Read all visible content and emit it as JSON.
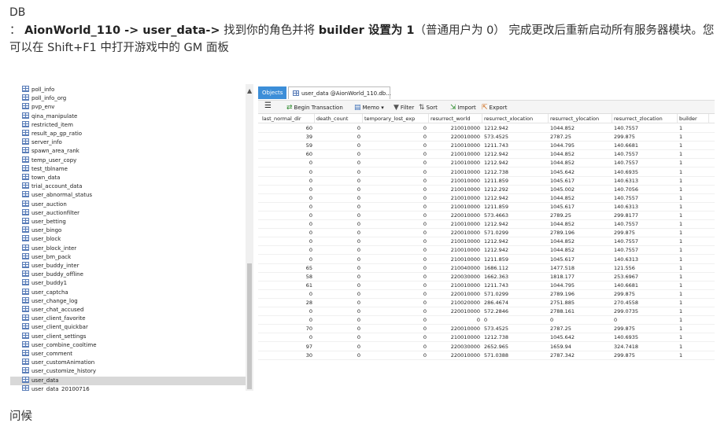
{
  "page": {
    "db_label": "DB",
    "instruction_prefix": "：",
    "instruction_path": "AionWorld_110 -> user_data->",
    "instruction_mid": " 找到你的角色并将 ",
    "instruction_bold2": "builder 设置为 1",
    "instruction_rest": "（普通用户为 0） 完成更改后重新启动所有服务器模块。您可以在 Shift+F1 中打开游戏中的 GM 面板",
    "greeting": "问候"
  },
  "tree": {
    "icon": "table-icon",
    "items": [
      "poll_info",
      "poll_info_org",
      "pvp_env",
      "qina_manipulate",
      "restricted_item",
      "result_ap_gp_ratio",
      "server_info",
      "spawn_area_rank",
      "temp_user_copy",
      "test_tblname",
      "town_data",
      "trial_account_data",
      "user_abnormal_status",
      "user_auction",
      "user_auctionfilter",
      "user_betting",
      "user_bingo",
      "user_block",
      "user_block_inter",
      "user_bm_pack",
      "user_buddy_inter",
      "user_buddy_offline",
      "user_buddy1",
      "user_captcha",
      "user_change_log",
      "user_chat_accused",
      "user_client_favorite",
      "user_client_quickbar",
      "user_client_settings",
      "user_combine_cooltime",
      "user_comment",
      "user_customAnimation",
      "user_customize_history",
      "user_data",
      "user_data_20100716"
    ],
    "selected": "user_data"
  },
  "tabs": {
    "objects": "Objects",
    "user_data": "user_data @AionWorld_110.db..."
  },
  "toolbar": {
    "begin_transaction": "Begin Transaction",
    "memo": "Memo",
    "filter": "Filter",
    "sort": "Sort",
    "import": "Import",
    "export": "Export"
  },
  "grid": {
    "columns": [
      "last_normal_dir",
      "death_count",
      "temporary_lost_exp",
      "resurrect_world",
      "resurrect_xlocation",
      "resurrect_ylocation",
      "resurrect_zlocation",
      "builder"
    ],
    "rows": [
      [
        "60",
        "0",
        "0",
        "210010000",
        "1212.942",
        "1044.852",
        "140.7557",
        "1"
      ],
      [
        "39",
        "0",
        "0",
        "220010000",
        "573.4525",
        "2787.25",
        "299.875",
        "1"
      ],
      [
        "59",
        "0",
        "0",
        "210010000",
        "1211.743",
        "1044.795",
        "140.6681",
        "1"
      ],
      [
        "60",
        "0",
        "0",
        "210010000",
        "1212.942",
        "1044.852",
        "140.7557",
        "1"
      ],
      [
        "0",
        "0",
        "0",
        "210010000",
        "1212.942",
        "1044.852",
        "140.7557",
        "1"
      ],
      [
        "0",
        "0",
        "0",
        "210010000",
        "1212.738",
        "1045.642",
        "140.6935",
        "1"
      ],
      [
        "0",
        "0",
        "0",
        "210010000",
        "1211.859",
        "1045.617",
        "140.6313",
        "1"
      ],
      [
        "0",
        "0",
        "0",
        "210010000",
        "1212.292",
        "1045.002",
        "140.7056",
        "1"
      ],
      [
        "0",
        "0",
        "0",
        "210010000",
        "1212.942",
        "1044.852",
        "140.7557",
        "1"
      ],
      [
        "0",
        "0",
        "0",
        "210010000",
        "1211.859",
        "1045.617",
        "140.6313",
        "1"
      ],
      [
        "0",
        "0",
        "0",
        "220010000",
        "573.4663",
        "2789.25",
        "299.8177",
        "1"
      ],
      [
        "0",
        "0",
        "0",
        "210010000",
        "1212.942",
        "1044.852",
        "140.7557",
        "1"
      ],
      [
        "0",
        "0",
        "0",
        "220010000",
        "571.0299",
        "2789.196",
        "299.875",
        "1"
      ],
      [
        "0",
        "0",
        "0",
        "210010000",
        "1212.942",
        "1044.852",
        "140.7557",
        "1"
      ],
      [
        "0",
        "0",
        "0",
        "210010000",
        "1212.942",
        "1044.852",
        "140.7557",
        "1"
      ],
      [
        "0",
        "0",
        "0",
        "210010000",
        "1211.859",
        "1045.617",
        "140.6313",
        "1"
      ],
      [
        "65",
        "0",
        "0",
        "210040000",
        "1686.112",
        "1477.518",
        "121.556",
        "1"
      ],
      [
        "58",
        "0",
        "0",
        "220030000",
        "1662.363",
        "1818.177",
        "253.6967",
        "1"
      ],
      [
        "61",
        "0",
        "0",
        "210010000",
        "1211.743",
        "1044.795",
        "140.6681",
        "1"
      ],
      [
        "0",
        "0",
        "0",
        "220010000",
        "571.0299",
        "2789.196",
        "299.875",
        "1"
      ],
      [
        "28",
        "0",
        "0",
        "210020000",
        "286.4674",
        "2751.885",
        "270.4558",
        "1"
      ],
      [
        "0",
        "0",
        "0",
        "220010000",
        "572.2846",
        "2788.161",
        "299.0735",
        "1"
      ],
      [
        "0",
        "0",
        "0",
        "0",
        "0",
        "0",
        "0",
        "1"
      ],
      [
        "70",
        "0",
        "0",
        "220010000",
        "573.4525",
        "2787.25",
        "299.875",
        "1"
      ],
      [
        "0",
        "0",
        "0",
        "210010000",
        "1212.738",
        "1045.642",
        "140.6935",
        "1"
      ],
      [
        "97",
        "0",
        "0",
        "220030000",
        "2652.965",
        "1659.94",
        "324.7418",
        "1"
      ],
      [
        "30",
        "0",
        "0",
        "220010000",
        "571.0388",
        "2787.342",
        "299.875",
        "1"
      ]
    ]
  }
}
